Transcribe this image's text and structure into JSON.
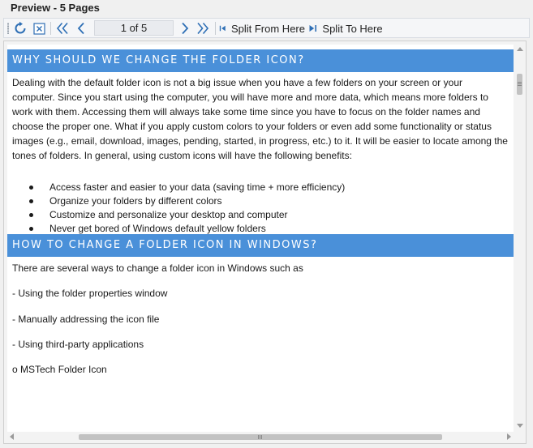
{
  "window": {
    "title": "Preview - 5 Pages"
  },
  "toolbar": {
    "page_indicator": "1 of 5",
    "split_from_label": "Split From Here",
    "split_to_label": "Split To Here"
  },
  "document": {
    "section1": {
      "heading": "WHY SHOULD WE CHANGE THE FOLDER ICON?",
      "paragraph_lines": [
        "Dealing with the default folder icon is not a big issue when you have a few folders on your screen or your",
        "computer. Since you start using the computer, you will have more and more data, which means more folders to",
        "work with them. Accessing them will always take some time since you have to focus on the folder names and",
        "choose the proper one. What if you apply custom colors to your folders or even add some functionality or status",
        "images (e.g., email, download, images, pending, started, in progress, etc.) to it. It will be easier to locate among the",
        "tones of folders. In general, using custom icons will have the following benefits:"
      ],
      "bullets": [
        "Access faster and easier to your data (saving time + more efficiency)",
        "Organize your folders by different colors",
        "Customize and personalize your desktop and computer",
        "Never get bored of Windows default yellow folders"
      ]
    },
    "section2": {
      "heading": "HOW TO CHANGE A FOLDER ICON IN WINDOWS?",
      "intro": "There are several ways to change a folder icon in Windows such as",
      "items": [
        "- Using the folder properties window",
        "- Manually addressing the icon file",
        "- Using third-party applications",
        "o MSTech Folder Icon"
      ]
    }
  },
  "colors": {
    "heading_bg": "#4a90d9",
    "toolbar_icon": "#2e6fb5"
  }
}
